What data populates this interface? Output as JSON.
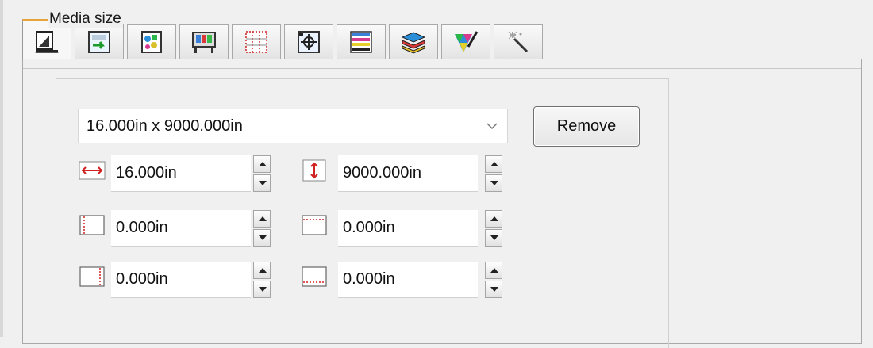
{
  "window": {
    "group_label": "Media size"
  },
  "tabs": [
    {
      "icon": "media-setup-icon",
      "active": true
    },
    {
      "icon": "media-feed-icon",
      "active": false
    },
    {
      "icon": "color-page-icon",
      "active": false
    },
    {
      "icon": "printer-icon",
      "active": false
    },
    {
      "icon": "grid-layout-icon",
      "active": false
    },
    {
      "icon": "registration-marks-icon",
      "active": false
    },
    {
      "icon": "color-bars-icon",
      "active": false
    },
    {
      "icon": "layers-icon",
      "active": false
    },
    {
      "icon": "color-picker-icon",
      "active": false
    },
    {
      "icon": "magic-wand-icon",
      "active": false
    }
  ],
  "media": {
    "selected_size": "16.000in x 9000.000in",
    "remove_label": "Remove"
  },
  "fields": {
    "width": "16.000in",
    "height": "9000.000in",
    "margin_left": "0.000in",
    "margin_top": "0.000in",
    "margin_right": "0.000in",
    "margin_bottom": "0.000in"
  },
  "colors": {
    "accent_red": "#d02020",
    "tab_active_accent": "#e8a33a"
  }
}
